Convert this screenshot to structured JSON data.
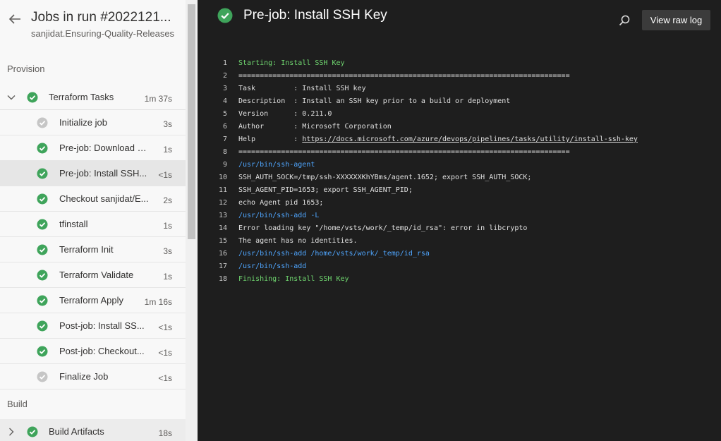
{
  "colors": {
    "success": "#3fa45b",
    "skipped": "#c6c6c6",
    "log_green": "#6fd66f",
    "log_blue": "#4fa6ff"
  },
  "sidebar": {
    "title": "Jobs in run #2022121...",
    "subtitle": "sanjidat.Ensuring-Quality-Releases",
    "back_icon": "arrow-left-icon",
    "sections": [
      {
        "title": "Provision"
      },
      {
        "title": "Build"
      }
    ],
    "stages": [
      {
        "label": "Terraform Tasks",
        "duration": "1m 37s",
        "status": "success",
        "expanded": true
      },
      {
        "label": "Build Artifacts",
        "duration": "18s",
        "status": "success",
        "expanded": false
      }
    ],
    "jobs": [
      {
        "label": "Initialize job",
        "duration": "3s",
        "status": "skipped"
      },
      {
        "label": "Pre-job: Download a...",
        "duration": "1s",
        "status": "success"
      },
      {
        "label": "Pre-job: Install SSH...",
        "duration": "<1s",
        "status": "success",
        "selected": true
      },
      {
        "label": "Checkout sanjidat/E...",
        "duration": "2s",
        "status": "success"
      },
      {
        "label": "tfinstall",
        "duration": "1s",
        "status": "success"
      },
      {
        "label": "Terraform Init",
        "duration": "3s",
        "status": "success"
      },
      {
        "label": "Terraform Validate",
        "duration": "1s",
        "status": "success"
      },
      {
        "label": "Terraform Apply",
        "duration": "1m 16s",
        "status": "success"
      },
      {
        "label": "Post-job: Install SS...",
        "duration": "<1s",
        "status": "success"
      },
      {
        "label": "Post-job: Checkout...",
        "duration": "<1s",
        "status": "success"
      },
      {
        "label": "Finalize Job",
        "duration": "<1s",
        "status": "skipped"
      }
    ]
  },
  "main": {
    "title": "Pre-job: Install SSH Key",
    "view_raw_label": "View raw log",
    "search_icon": "search-icon",
    "log_lines": [
      {
        "n": "1",
        "text": "Starting: Install SSH Key",
        "style": "green"
      },
      {
        "n": "2",
        "text": "==============================================================================",
        "style": "normal"
      },
      {
        "n": "3",
        "text": "Task         : Install SSH key",
        "style": "normal"
      },
      {
        "n": "4",
        "text": "Description  : Install an SSH key prior to a build or deployment",
        "style": "normal"
      },
      {
        "n": "5",
        "text": "Version      : 0.211.0",
        "style": "normal"
      },
      {
        "n": "6",
        "text": "Author       : Microsoft Corporation",
        "style": "normal"
      },
      {
        "n": "7",
        "text": "Help         : ",
        "link": "https://docs.microsoft.com/azure/devops/pipelines/tasks/utility/install-ssh-key",
        "style": "normal"
      },
      {
        "n": "8",
        "text": "==============================================================================",
        "style": "normal"
      },
      {
        "n": "9",
        "text": "/usr/bin/ssh-agent",
        "style": "blue"
      },
      {
        "n": "10",
        "text": "SSH_AUTH_SOCK=/tmp/ssh-XXXXXXKhYBms/agent.1652; export SSH_AUTH_SOCK;",
        "style": "normal"
      },
      {
        "n": "11",
        "text": "SSH_AGENT_PID=1653; export SSH_AGENT_PID;",
        "style": "normal"
      },
      {
        "n": "12",
        "text": "echo Agent pid 1653;",
        "style": "normal"
      },
      {
        "n": "13",
        "text": "/usr/bin/ssh-add -L",
        "style": "blue"
      },
      {
        "n": "14",
        "text": "Error loading key \"/home/vsts/work/_temp/id_rsa\": error in libcrypto",
        "style": "normal"
      },
      {
        "n": "15",
        "text": "The agent has no identities.",
        "style": "normal"
      },
      {
        "n": "16",
        "text": "/usr/bin/ssh-add /home/vsts/work/_temp/id_rsa",
        "style": "blue"
      },
      {
        "n": "17",
        "text": "/usr/bin/ssh-add",
        "style": "blue"
      },
      {
        "n": "18",
        "text": "Finishing: Install SSH Key",
        "style": "green"
      }
    ]
  }
}
